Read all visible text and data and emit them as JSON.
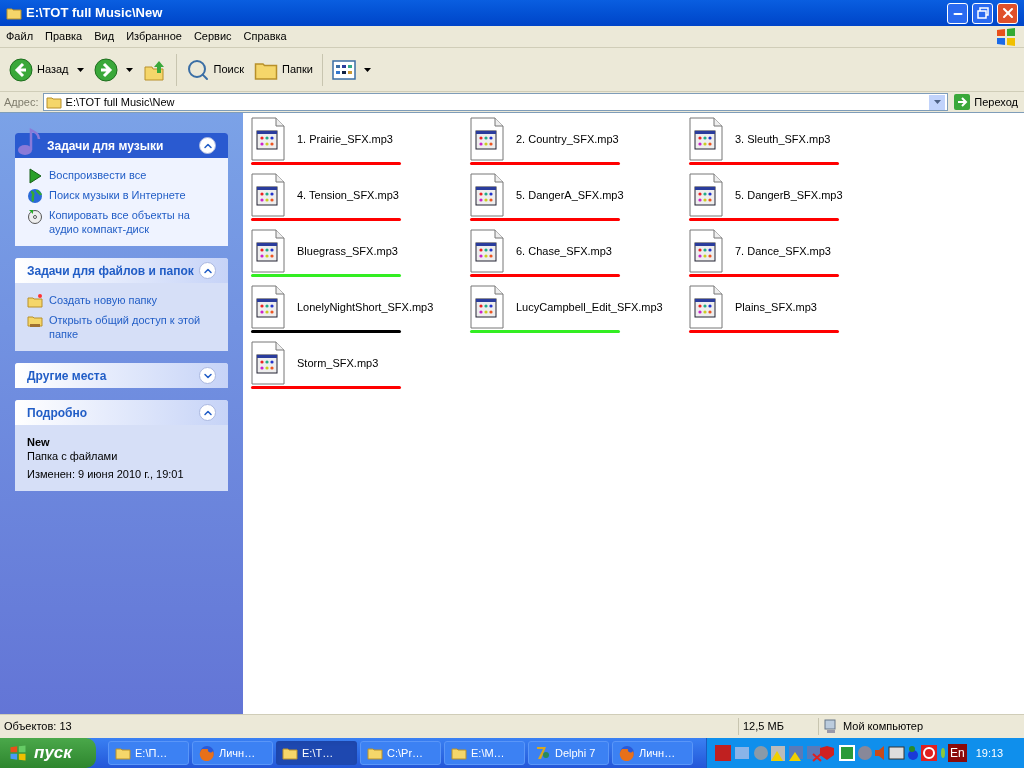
{
  "window": {
    "title": "E:\\TOT full Music\\New"
  },
  "menu": [
    "Файл",
    "Правка",
    "Вид",
    "Избранное",
    "Сервис",
    "Справка"
  ],
  "toolbar": [
    {
      "kind": "back",
      "label": "Назад"
    },
    {
      "kind": "forward"
    },
    {
      "kind": "up"
    },
    {
      "kind": "search",
      "label": "Поиск"
    },
    {
      "kind": "folders",
      "label": "Папки"
    },
    {
      "kind": "views"
    }
  ],
  "address": {
    "label": "Адрес:",
    "value": "E:\\TOT full Music\\New",
    "go": "Переход"
  },
  "sidebar": [
    {
      "kind": "music",
      "title": "Задачи для музыки",
      "expanded": true,
      "items": [
        {
          "kind": "play",
          "label": "Воспроизвести все"
        },
        {
          "kind": "globe",
          "label": "Поиск музыки в Интернете"
        },
        {
          "kind": "cd",
          "label": "Копировать все объекты на аудио компакт-диск"
        }
      ]
    },
    {
      "kind": "tasks",
      "title": "Задачи для файлов и папок",
      "expanded": true,
      "items": [
        {
          "kind": "newfolder",
          "label": "Создать новую папку"
        },
        {
          "kind": "share",
          "label": "Открыть общий доступ к этой папке"
        }
      ]
    },
    {
      "kind": "places",
      "title": "Другие места",
      "expanded": false
    },
    {
      "kind": "details",
      "title": "Подробно",
      "expanded": true,
      "details": {
        "name": "New",
        "type": "Папка с файлами",
        "modified": "Изменен: 9 июня 2010 г., 19:01"
      }
    }
  ],
  "files": [
    {
      "name": "1. Prairie_SFX.mp3",
      "color": "#ff0000"
    },
    {
      "name": "2. Country_SFX.mp3",
      "color": "#ff0000"
    },
    {
      "name": "3. Sleuth_SFX.mp3",
      "color": "#ff0000"
    },
    {
      "name": "4. Tension_SFX.mp3",
      "color": "#ff0000"
    },
    {
      "name": "5. DangerA_SFX.mp3",
      "color": "#ff0000"
    },
    {
      "name": "5. DangerB_SFX.mp3",
      "color": "#ff0000"
    },
    {
      "name": "Bluegrass_SFX.mp3",
      "color": "#33ee22"
    },
    {
      "name": "6. Chase_SFX.mp3",
      "color": "#ff0000"
    },
    {
      "name": "7. Dance_SFX.mp3",
      "color": "#ff0000"
    },
    {
      "name": "LonelyNightShort_SFX.mp3",
      "color": "#000000"
    },
    {
      "name": "LucyCampbell_Edit_SFX.mp3",
      "color": "#33ee22"
    },
    {
      "name": "Plains_SFX.mp3",
      "color": "#ff0000"
    },
    {
      "name": "Storm_SFX.mp3",
      "color": "#ff0000"
    }
  ],
  "status_bar": {
    "objects": "Объектов: 13",
    "size": "12,5 МБ",
    "location": "Мой компьютер"
  },
  "taskbar": {
    "start": "пуск",
    "tasks": [
      {
        "kind": "folder",
        "label": "E:\\П…",
        "selected": false
      },
      {
        "kind": "browser",
        "label": "Личн…",
        "selected": false
      },
      {
        "kind": "folder",
        "label": "E:\\T…",
        "selected": true
      },
      {
        "kind": "folder",
        "label": "C:\\Pr…",
        "selected": false
      },
      {
        "kind": "folder",
        "label": "E:\\M…",
        "selected": false
      },
      {
        "kind": "delphi",
        "label": "Delphi 7",
        "selected": false
      },
      {
        "kind": "browser",
        "label": "Личн…",
        "selected": false
      }
    ],
    "language": "En",
    "clock": "19:13"
  }
}
